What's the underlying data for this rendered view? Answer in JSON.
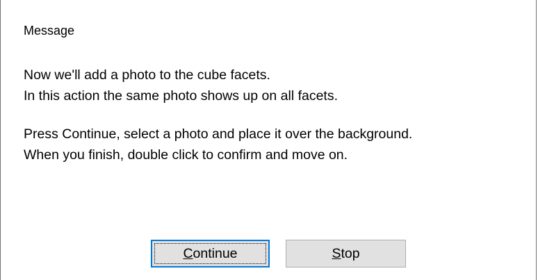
{
  "dialog": {
    "title": "Message",
    "lines": [
      "Now we'll add a photo to the cube facets.",
      "In this action the same photo shows up on all facets.",
      "Press Continue, select a photo and place it over the background.",
      "When you finish, double click to confirm and move on."
    ],
    "buttons": {
      "continue": {
        "mnemonic": "C",
        "rest": "ontinue"
      },
      "stop": {
        "mnemonic": "S",
        "rest": "top"
      }
    }
  }
}
